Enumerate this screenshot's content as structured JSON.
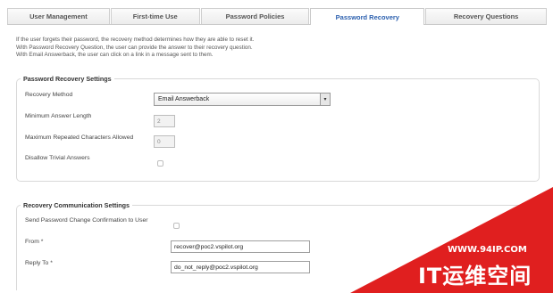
{
  "tabs": [
    {
      "label": "User Management",
      "active": false
    },
    {
      "label": "First-time Use",
      "active": false
    },
    {
      "label": "Password Policies",
      "active": false
    },
    {
      "label": "Password Recovery",
      "active": true
    },
    {
      "label": "Recovery Questions",
      "active": false
    }
  ],
  "intro": {
    "line1": "If the user forgets their password, the recovery method determines how they are able to reset it.",
    "line2": "With Password Recovery Question, the user can provide the answer to their recovery question.",
    "line3": "With Email Answerback, the user can click on a link in a message sent to them."
  },
  "recovery_settings": {
    "legend": "Password Recovery Settings",
    "method_label": "Recovery Method",
    "method_value": "Email Answerback",
    "min_length_label": "Minimum Answer Length",
    "min_length_value": "2",
    "max_repeat_label": "Maximum Repeated Characters Allowed",
    "max_repeat_value": "0",
    "disallow_label": "Disallow Trivial Answers",
    "disallow_checked": false
  },
  "communication_settings": {
    "legend": "Recovery Communication Settings",
    "send_confirm_label": "Send Password Change Confirmation to User",
    "send_confirm_checked": false,
    "from_label": "From *",
    "from_value": "recover@poc2.vspilot.org",
    "reply_to_label": "Reply To *",
    "reply_to_value": "do_not_reply@poc2.vspilot.org"
  },
  "watermark": {
    "host": "WWW.94IP.COM",
    "brand": "IT运维空间",
    "color": "#e01f1f"
  },
  "colors": {
    "active_tab_text": "#2b5fae",
    "watermark_red": "#e01f1f"
  }
}
